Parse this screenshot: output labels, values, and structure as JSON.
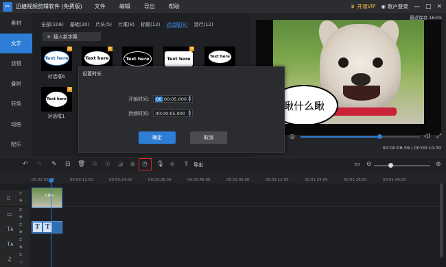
{
  "app": {
    "title": "迅捷视频剪辑软件 (免费版)",
    "logo_icon": "scissors-app-icon",
    "menu": [
      "文件",
      "编辑",
      "导出",
      "帮助"
    ],
    "vip_label": "开通VIP",
    "login_label": "账户登录",
    "window_controls": [
      "—",
      "□",
      "✕"
    ]
  },
  "sidebar": {
    "items": [
      {
        "label": "素材",
        "active": false
      },
      {
        "label": "文字",
        "active": true
      },
      {
        "label": "滤镜",
        "active": false
      },
      {
        "label": "叠附",
        "active": false
      },
      {
        "label": "转场",
        "active": false
      },
      {
        "label": "动画",
        "active": false
      },
      {
        "label": "配乐",
        "active": false
      }
    ]
  },
  "library": {
    "tabs": [
      {
        "label": "全部(106)",
        "active": false
      },
      {
        "label": "基础(20)",
        "active": false
      },
      {
        "label": "片头(5)",
        "active": false
      },
      {
        "label": "片尾(8)",
        "active": false
      },
      {
        "label": "标题(12)",
        "active": false
      },
      {
        "label": "对话框(8)",
        "active": true
      },
      {
        "label": "流行(12)",
        "active": false
      }
    ],
    "add_button": "插入新字幕",
    "thumbs": [
      {
        "text": "Text here",
        "label": "对话框6"
      },
      {
        "text": "Text here",
        "label": ""
      },
      {
        "text": "Text here",
        "label": ""
      },
      {
        "text": "Text here",
        "label": ""
      },
      {
        "text": "Text here",
        "label": ""
      },
      {
        "text": "Text here",
        "label": "对话框1"
      }
    ]
  },
  "preview": {
    "label": "最近保存 16:05",
    "bubble_text": "瞅什么瞅",
    "progress": 0.66,
    "time": "00:00:06.59 / 00:00:10.00"
  },
  "dialog": {
    "title": "设置时长",
    "start_label": "开始时间:",
    "start_sel": "00",
    "start_rest": ":00:05.000",
    "duration_label": "持续时间:",
    "duration_sel": "00",
    "duration_rest": ":00:05.000",
    "ok": "确定",
    "cancel": "取消"
  },
  "toolbar": {
    "export_label": "导出"
  },
  "timeline": {
    "ruler": [
      "00:00:00.00",
      "00:00:12.00",
      "00:00:24.00",
      "00:00:36.00",
      "00:00:48.00",
      "00:01:00.00",
      "00:01:12.00",
      "00:01:24.00",
      "00:01:36.00",
      "00:01:48.00"
    ],
    "text_chips": [
      "T",
      "T"
    ],
    "clip_label": "3.JPG"
  }
}
